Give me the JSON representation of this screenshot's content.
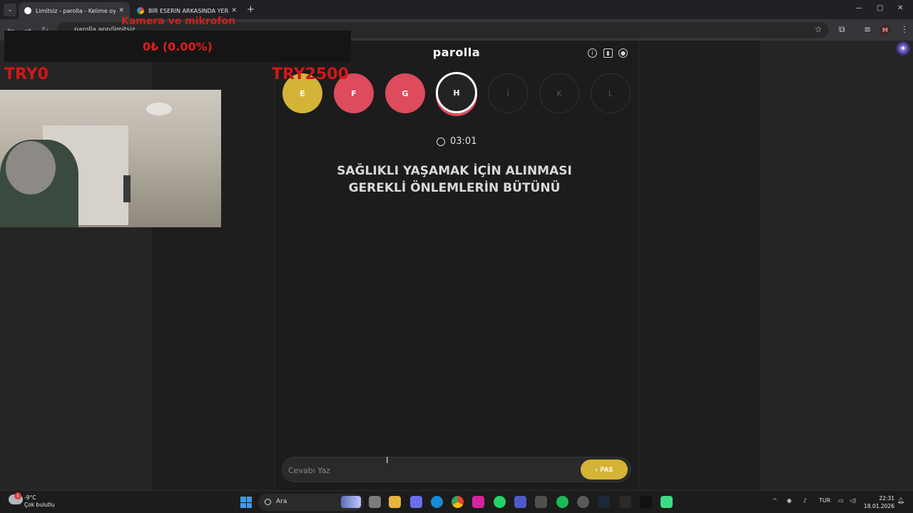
{
  "browser": {
    "tabs": [
      {
        "title": "Limitsiz - parolla - Kelime oyunu",
        "active": true
      },
      {
        "title": "BİR ESERİN ARKASINDA YER ALAN",
        "active": false
      }
    ],
    "url": "parolla.app/limitsiz"
  },
  "overlay": {
    "title": "Kamera ve mikrofon",
    "amount": "0₺ (0.00%)",
    "try_left": "TRY0",
    "try_right": "TRY2500"
  },
  "game": {
    "logo": "parolla",
    "header_icons": [
      "info-icon",
      "stats-icon",
      "account-icon"
    ],
    "letters": [
      {
        "letter": "E",
        "state": "correct"
      },
      {
        "letter": "F",
        "state": "wrong"
      },
      {
        "letter": "G",
        "state": "wrong"
      },
      {
        "letter": "H",
        "state": "current"
      },
      {
        "letter": "İ",
        "state": "pending"
      },
      {
        "letter": "K",
        "state": "pending"
      },
      {
        "letter": "L",
        "state": "pending"
      }
    ],
    "timer": "03:01",
    "question_line1": "SAĞLIKLI YAŞAMAK İÇİN ALINMASI",
    "question_line2": "GEREKLİ ÖNLEMLERİN BÜTÜNÜ",
    "answer_placeholder": "Cevabı Yaz",
    "pass_label": "PAS"
  },
  "colors": {
    "correct": "#d4b437",
    "wrong": "#dd4b5c",
    "overlay_red": "#d11717"
  },
  "taskbar": {
    "temperature": "-9°C",
    "weather": "Çok bulutlu",
    "weather_badge": "5",
    "search_label": "Ara",
    "language": "TUR",
    "time": "22:31",
    "date": "18.01.2026"
  }
}
